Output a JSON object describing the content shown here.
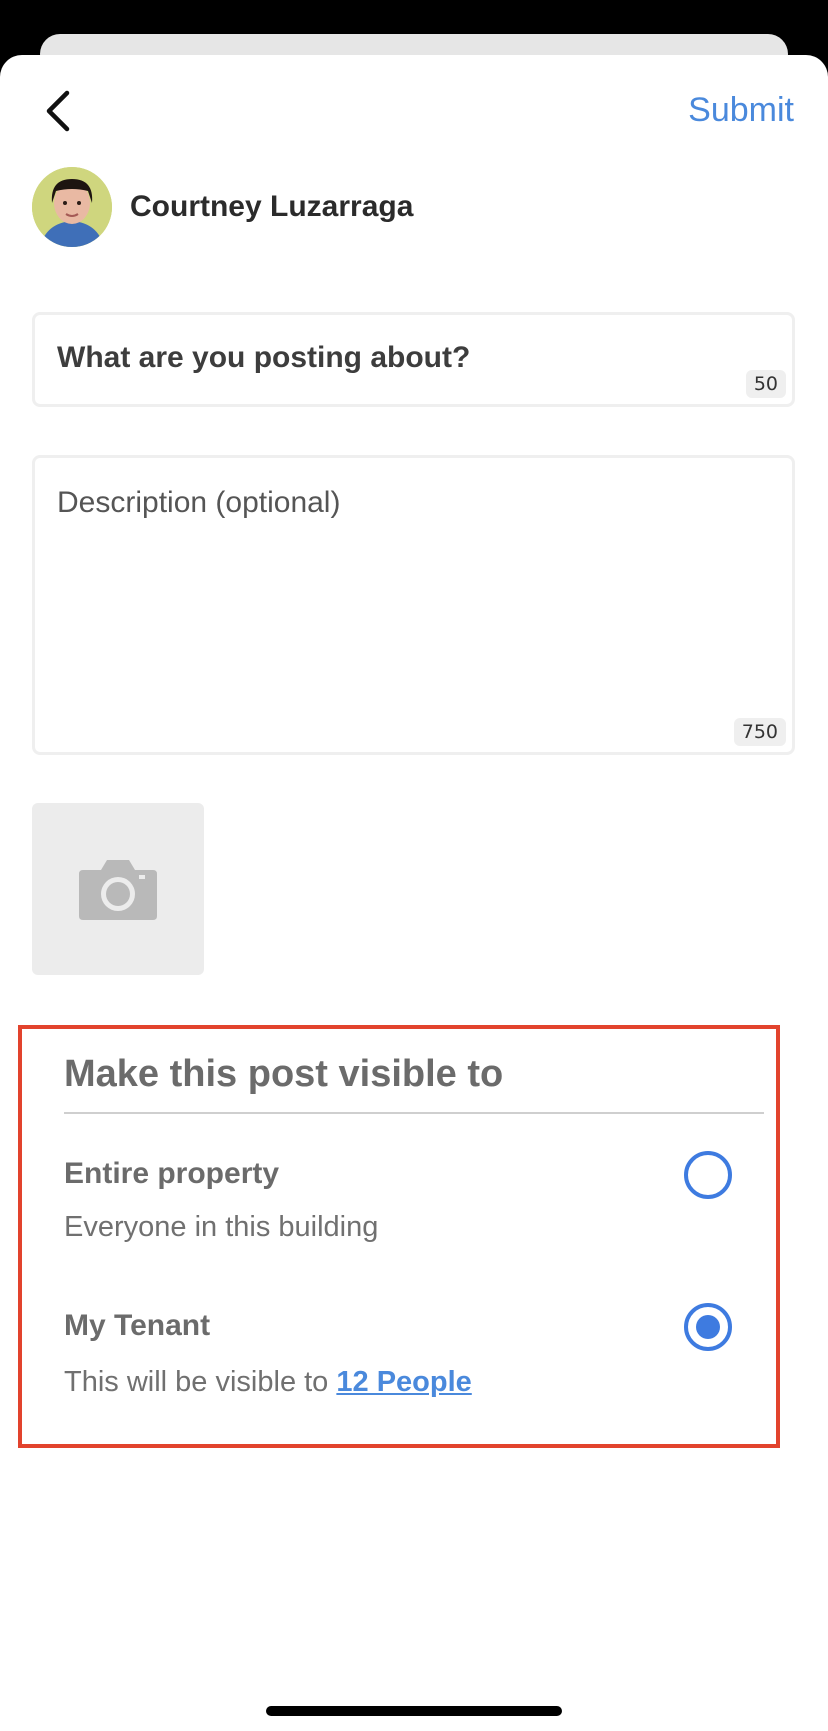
{
  "header": {
    "submit_label": "Submit"
  },
  "author": {
    "name": "Courtney Luzarraga"
  },
  "title_field": {
    "placeholder": "What are you posting about?",
    "char_limit": "50"
  },
  "description_field": {
    "placeholder": "Description (optional)",
    "char_limit": "750"
  },
  "photo": {
    "icon": "camera-icon"
  },
  "visibility": {
    "heading": "Make this post visible to",
    "options": [
      {
        "title": "Entire property",
        "subtitle": "Everyone in this building",
        "selected": false
      },
      {
        "title": "My Tenant",
        "subtitle_prefix": "This will be visible to ",
        "link_text": "12 People",
        "selected": true
      }
    ]
  },
  "colors": {
    "accent": "#3e7be0",
    "highlight_border": "#e2432d"
  }
}
